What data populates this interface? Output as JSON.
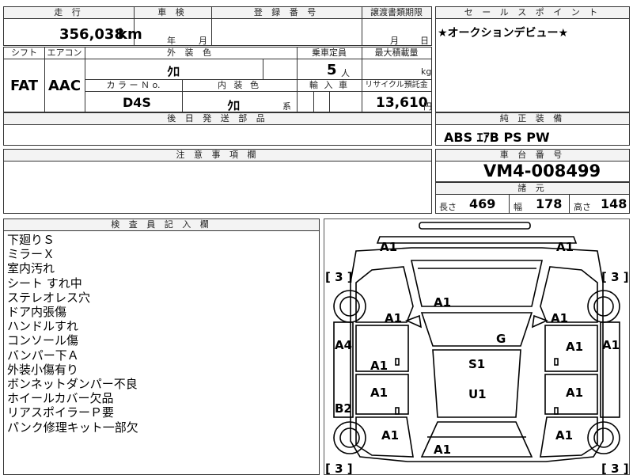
{
  "top": {
    "mileage_label": "走 行",
    "mileage_value": "356,038",
    "mileage_unit": "km",
    "inspection_label": "車 検",
    "inspection_year": "年",
    "inspection_month": "月",
    "registration_label": "登 録 番 号",
    "transfer_label": "譲渡書類期限",
    "transfer_month": "月",
    "transfer_day": "日"
  },
  "specs": {
    "shift_label": "シフト",
    "shift_value": "FAT",
    "aircon_label": "エアコン",
    "aircon_value": "AAC",
    "ext_color_label": "外 装 色",
    "ext_color_value": "ｸﾛ",
    "capacity_label": "乗車定員",
    "capacity_value": "5",
    "capacity_unit": "人",
    "max_load_label": "最大積載量",
    "max_load_unit": "kg",
    "color_no_label": "カ ラ ー Ｎ o.",
    "color_no_value": "D4S",
    "int_color_label": "内 装 色",
    "int_color_value": "ｸﾛ",
    "int_color_suffix": "系",
    "import_label": "輸 入 車",
    "recycle_label": "リサイクル預託金",
    "recycle_value": "13,610",
    "recycle_unit": "円"
  },
  "later_parts_label": "後 日 発 送 部 品",
  "sales_point": {
    "label": "セ ー ル ス ポ イ ン ト",
    "text": "★オークションデビュー★"
  },
  "equipment": {
    "label": "純 正 装 備",
    "value": "ABS ｴｱB PS PW"
  },
  "caution_label": "注 意 事 項 欄",
  "chassis": {
    "label": "車 台 番 号",
    "value": "VM4-008499"
  },
  "dimensions": {
    "label": "諸 元",
    "length_label": "長さ",
    "length_value": "469",
    "width_label": "幅",
    "width_value": "178",
    "height_label": "高さ",
    "height_value": "148"
  },
  "inspector": {
    "label": "検 査 員 記 入 欄",
    "notes": [
      "下廻りＳ",
      "ミラーＸ",
      "室内汚れ",
      "シート すれ中",
      "ステレオレス穴",
      "ドア内張傷",
      "ハンドルすれ",
      "コンソール傷",
      "バンパー下Ａ",
      "外装小傷有り",
      "ボンネットダンパー不良",
      "ホイールカバー欠品",
      "リアスポイラーＰ要",
      "パンク修理キット一部欠"
    ]
  },
  "diagram": {
    "marks": {
      "front_left": "A1",
      "front_right": "A1",
      "hood": "A1",
      "fender_left": "A1",
      "fender_right": "A1",
      "side_left": "A4",
      "side_right": "A1",
      "front_door_left": "A1",
      "front_door_right": "A1",
      "roof_front": "S1",
      "roof_rear": "U1",
      "windshield": "G",
      "rear_door_left": "A1",
      "rear_door_right": "A1",
      "rocker_left": "B2",
      "rear_fender_left": "A1",
      "rear_fender_right": "A1",
      "trunk": "A1"
    },
    "tire_tl": "[ 3 ]",
    "tire_tr": "[ 3 ]",
    "tire_bl": "[ 3 ]",
    "tire_br": "[ 3 ]"
  }
}
